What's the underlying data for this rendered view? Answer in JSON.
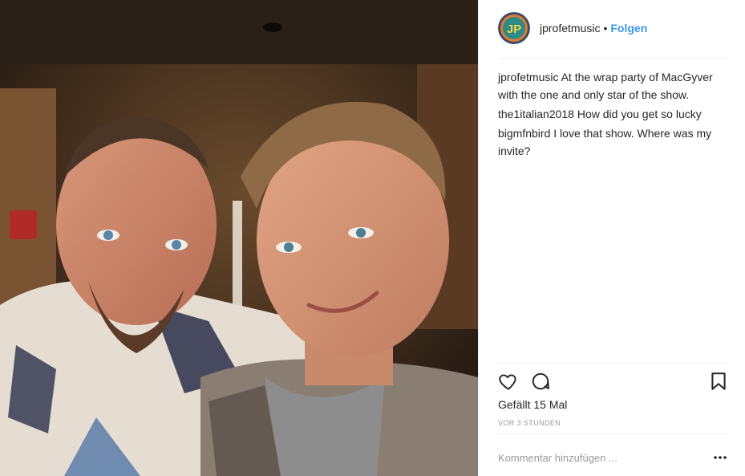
{
  "post": {
    "author": "jprofetmusic",
    "follow_label": "Folgen",
    "separator": "•",
    "caption": {
      "user": "jprofetmusic",
      "text": "At the wrap party of MacGyver with the one and only star of the show."
    },
    "comments": [
      {
        "user": "the1italian2018",
        "text": "How did you get so lucky"
      },
      {
        "user": "bigmfnbird",
        "text": "I love that show. Where was my invite?"
      }
    ],
    "likes_label": "Gefällt 15 Mal",
    "timestamp": "VOR 3 STUNDEN",
    "add_comment_placeholder": "Kommentar hinzufügen ...",
    "avatar_text": "JP"
  },
  "icons": {
    "like": "heart-icon",
    "comment": "comment-bubble-icon",
    "save": "bookmark-icon",
    "more": "more-options-icon"
  },
  "colors": {
    "follow": "#3897f0",
    "text": "#262626",
    "muted": "#999999",
    "divider": "#efefef"
  }
}
